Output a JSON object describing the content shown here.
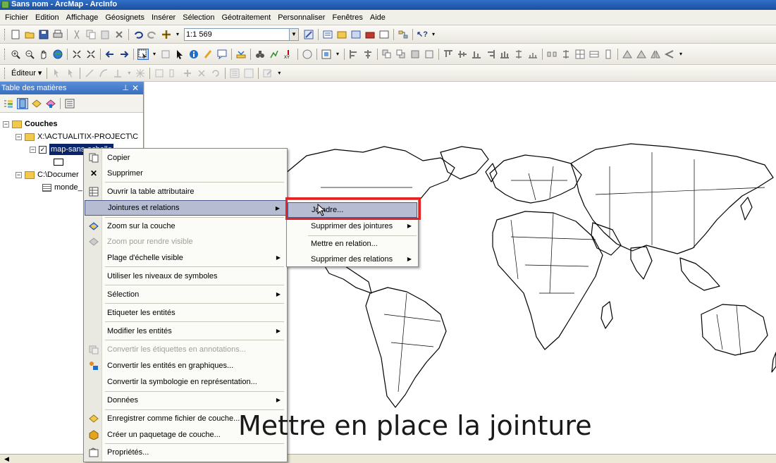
{
  "window": {
    "title": "Sans nom - ArcMap - ArcInfo"
  },
  "menubar": {
    "items": [
      "Fichier",
      "Edition",
      "Affichage",
      "Géosignets",
      "Insérer",
      "Sélection",
      "Géotraitement",
      "Personnaliser",
      "Fenêtres",
      "Aide"
    ]
  },
  "toolbar": {
    "scale": "1:1 569",
    "editor_label": "Éditeur ▾"
  },
  "toc": {
    "title": "Table des matières",
    "root": "Couches",
    "group1": "X:\\ACTUALITIX-PROJECT\\C",
    "layer": "map-sans-echelle",
    "group2": "C:\\Documer",
    "table": "monde_"
  },
  "context_menu": {
    "items": [
      {
        "label": "Copier",
        "icon": "copy-icon"
      },
      {
        "label": "Supprimer",
        "icon": "delete-icon"
      },
      {
        "label": "Ouvrir la table attributaire",
        "icon": "table-icon"
      },
      {
        "label": "Jointures et relations",
        "icon": "",
        "submenu": true,
        "highlighted": true
      },
      {
        "label": "Zoom sur la couche",
        "icon": "zoom-layer-icon"
      },
      {
        "label": "Zoom pour rendre visible",
        "icon": "zoom-visible-icon",
        "disabled": true
      },
      {
        "label": "Plage d'échelle visible",
        "icon": "",
        "submenu": true
      },
      {
        "label": "Utiliser les niveaux de symboles",
        "icon": ""
      },
      {
        "label": "Sélection",
        "icon": "",
        "submenu": true
      },
      {
        "label": "Etiqueter les entités",
        "icon": ""
      },
      {
        "label": "Modifier les entités",
        "icon": "",
        "submenu": true
      },
      {
        "label": "Convertir les étiquettes en annotations...",
        "icon": "annotation-icon",
        "disabled": true
      },
      {
        "label": "Convertir les entités en graphiques...",
        "icon": "graphics-icon"
      },
      {
        "label": "Convertir la symbologie en représentation...",
        "icon": ""
      },
      {
        "label": "Données",
        "icon": "",
        "submenu": true
      },
      {
        "label": "Enregistrer comme fichier de couche...",
        "icon": "save-layer-icon"
      },
      {
        "label": "Créer un paquetage de couche...",
        "icon": "package-icon"
      },
      {
        "label": "Propriétés...",
        "icon": "properties-icon"
      }
    ]
  },
  "submenu": {
    "items": [
      {
        "label": "Joindre...",
        "highlighted": true
      },
      {
        "label": "Supprimer des jointures",
        "submenu": true
      },
      {
        "label": "Mettre en relation..."
      },
      {
        "label": "Supprimer des relations",
        "submenu": true
      }
    ]
  },
  "caption": "Mettre en place la jointure",
  "colors": {
    "highlight_box": "#e52224",
    "menu_highlight": "#b6bdd2",
    "title_bar": "#2f6fc9"
  }
}
